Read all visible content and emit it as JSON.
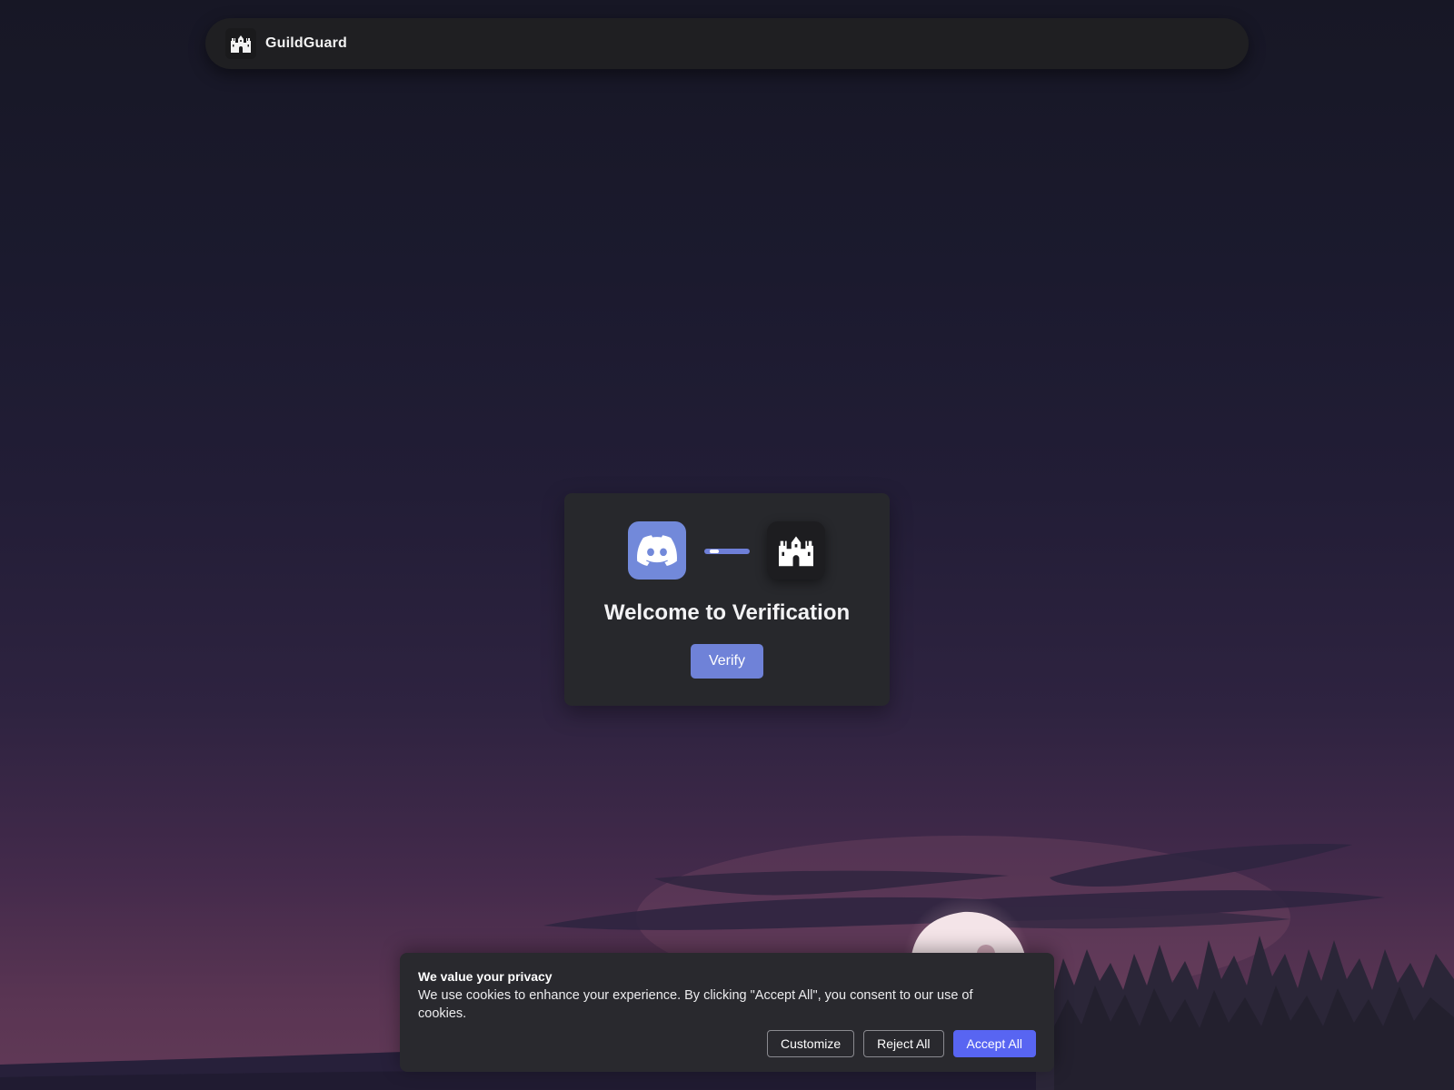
{
  "navbar": {
    "brand_name": "GuildGuard",
    "brand_icon": "castle-icon"
  },
  "card": {
    "left_icon": "discord-icon",
    "right_icon": "castle-icon",
    "title": "Welcome to Verification",
    "verify_label": "Verify"
  },
  "cookie_banner": {
    "title": "We value your privacy",
    "text": "We use cookies to enhance your experience. By clicking \"Accept All\", you consent to our use of cookies.",
    "customize_label": "Customize",
    "reject_label": "Reject All",
    "accept_label": "Accept All"
  },
  "colors": {
    "discord_blurple": "#7289da",
    "verify_button": "#6f82d8",
    "accept_button": "#5865f2",
    "card_bg": "#27282c",
    "navbar_bg": "#1f1f22"
  }
}
